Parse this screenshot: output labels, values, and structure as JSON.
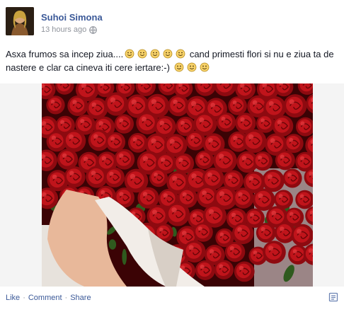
{
  "post": {
    "author": "Suhoi Simona",
    "timestamp": "13 hours ago",
    "privacy_icon": "globe-icon",
    "text_parts": {
      "p1": "Asxa frumos sa incep ziua....",
      "p2": "cand primesti flori si nu e ziua ta de nastere e clar ca cineva iti cere iertare:-)"
    },
    "emoticons_first_group": 5,
    "emoticons_second_group": 3,
    "photo_subject": "red roses bouquet"
  },
  "actions": {
    "like": "Like",
    "comment": "Comment",
    "share": "Share",
    "separator": "·"
  },
  "colors": {
    "link": "#3b5998",
    "meta": "#90949c",
    "rose": "#c0141b"
  }
}
